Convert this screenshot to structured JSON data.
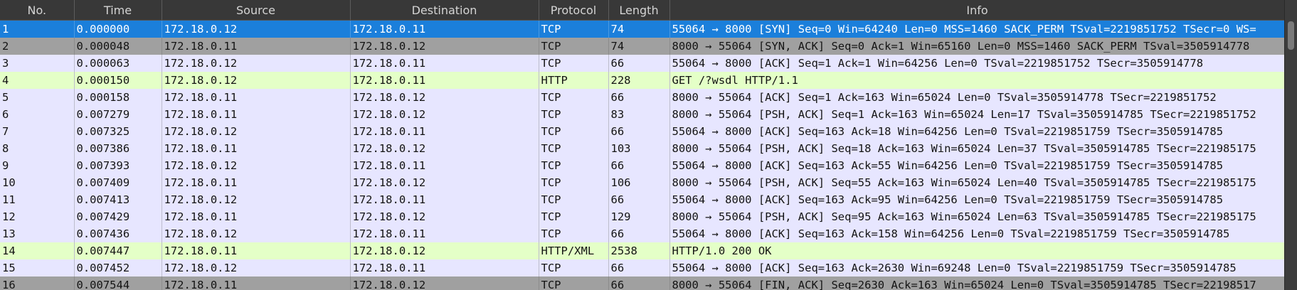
{
  "columns": [
    "No.",
    "Time",
    "Source",
    "Destination",
    "Protocol",
    "Length",
    "Info"
  ],
  "colors": {
    "tcp": "#e7e6ff",
    "http": "#e4ffc7",
    "gray": "#a0a0a0",
    "selected": "#1b7fdb",
    "header": "#383838"
  },
  "rows": [
    {
      "no": "1",
      "time": "0.000000",
      "src": "172.18.0.12",
      "dst": "172.18.0.11",
      "proto": "TCP",
      "len": "74",
      "info": "55064 → 8000 [SYN] Seq=0 Win=64240 Len=0 MSS=1460 SACK_PERM TSval=2219851752 TSecr=0 WS=",
      "style": "selected"
    },
    {
      "no": "2",
      "time": "0.000048",
      "src": "172.18.0.11",
      "dst": "172.18.0.12",
      "proto": "TCP",
      "len": "74",
      "info": "8000 → 55064 [SYN, ACK] Seq=0 Ack=1 Win=65160 Len=0 MSS=1460 SACK_PERM TSval=3505914778",
      "style": "gray"
    },
    {
      "no": "3",
      "time": "0.000063",
      "src": "172.18.0.12",
      "dst": "172.18.0.11",
      "proto": "TCP",
      "len": "66",
      "info": "55064 → 8000 [ACK] Seq=1 Ack=1 Win=64256 Len=0 TSval=2219851752 TSecr=3505914778",
      "style": "tcp"
    },
    {
      "no": "4",
      "time": "0.000150",
      "src": "172.18.0.12",
      "dst": "172.18.0.11",
      "proto": "HTTP",
      "len": "228",
      "info": "GET /?wsdl HTTP/1.1",
      "style": "http"
    },
    {
      "no": "5",
      "time": "0.000158",
      "src": "172.18.0.11",
      "dst": "172.18.0.12",
      "proto": "TCP",
      "len": "66",
      "info": "8000 → 55064 [ACK] Seq=1 Ack=163 Win=65024 Len=0 TSval=3505914778 TSecr=2219851752",
      "style": "tcp"
    },
    {
      "no": "6",
      "time": "0.007279",
      "src": "172.18.0.11",
      "dst": "172.18.0.12",
      "proto": "TCP",
      "len": "83",
      "info": "8000 → 55064 [PSH, ACK] Seq=1 Ack=163 Win=65024 Len=17 TSval=3505914785 TSecr=2219851752",
      "style": "tcp"
    },
    {
      "no": "7",
      "time": "0.007325",
      "src": "172.18.0.12",
      "dst": "172.18.0.11",
      "proto": "TCP",
      "len": "66",
      "info": "55064 → 8000 [ACK] Seq=163 Ack=18 Win=64256 Len=0 TSval=2219851759 TSecr=3505914785",
      "style": "tcp"
    },
    {
      "no": "8",
      "time": "0.007386",
      "src": "172.18.0.11",
      "dst": "172.18.0.12",
      "proto": "TCP",
      "len": "103",
      "info": "8000 → 55064 [PSH, ACK] Seq=18 Ack=163 Win=65024 Len=37 TSval=3505914785 TSecr=221985175",
      "style": "tcp"
    },
    {
      "no": "9",
      "time": "0.007393",
      "src": "172.18.0.12",
      "dst": "172.18.0.11",
      "proto": "TCP",
      "len": "66",
      "info": "55064 → 8000 [ACK] Seq=163 Ack=55 Win=64256 Len=0 TSval=2219851759 TSecr=3505914785",
      "style": "tcp"
    },
    {
      "no": "10",
      "time": "0.007409",
      "src": "172.18.0.11",
      "dst": "172.18.0.12",
      "proto": "TCP",
      "len": "106",
      "info": "8000 → 55064 [PSH, ACK] Seq=55 Ack=163 Win=65024 Len=40 TSval=3505914785 TSecr=221985175",
      "style": "tcp"
    },
    {
      "no": "11",
      "time": "0.007413",
      "src": "172.18.0.12",
      "dst": "172.18.0.11",
      "proto": "TCP",
      "len": "66",
      "info": "55064 → 8000 [ACK] Seq=163 Ack=95 Win=64256 Len=0 TSval=2219851759 TSecr=3505914785",
      "style": "tcp"
    },
    {
      "no": "12",
      "time": "0.007429",
      "src": "172.18.0.11",
      "dst": "172.18.0.12",
      "proto": "TCP",
      "len": "129",
      "info": "8000 → 55064 [PSH, ACK] Seq=95 Ack=163 Win=65024 Len=63 TSval=3505914785 TSecr=221985175",
      "style": "tcp"
    },
    {
      "no": "13",
      "time": "0.007436",
      "src": "172.18.0.12",
      "dst": "172.18.0.11",
      "proto": "TCP",
      "len": "66",
      "info": "55064 → 8000 [ACK] Seq=163 Ack=158 Win=64256 Len=0 TSval=2219851759 TSecr=3505914785",
      "style": "tcp"
    },
    {
      "no": "14",
      "time": "0.007447",
      "src": "172.18.0.11",
      "dst": "172.18.0.12",
      "proto": "HTTP/XML",
      "len": "2538",
      "info": "HTTP/1.0 200 OK",
      "style": "http"
    },
    {
      "no": "15",
      "time": "0.007452",
      "src": "172.18.0.12",
      "dst": "172.18.0.11",
      "proto": "TCP",
      "len": "66",
      "info": "55064 → 8000 [ACK] Seq=163 Ack=2630 Win=69248 Len=0 TSval=2219851759 TSecr=3505914785",
      "style": "tcp"
    },
    {
      "no": "16",
      "time": "0.007544",
      "src": "172.18.0.11",
      "dst": "172.18.0.12",
      "proto": "TCP",
      "len": "66",
      "info": "8000 → 55064 [FIN, ACK] Seq=2630 Ack=163 Win=65024 Len=0 TSval=3505914785 TSecr=22198517",
      "style": "gray"
    }
  ]
}
